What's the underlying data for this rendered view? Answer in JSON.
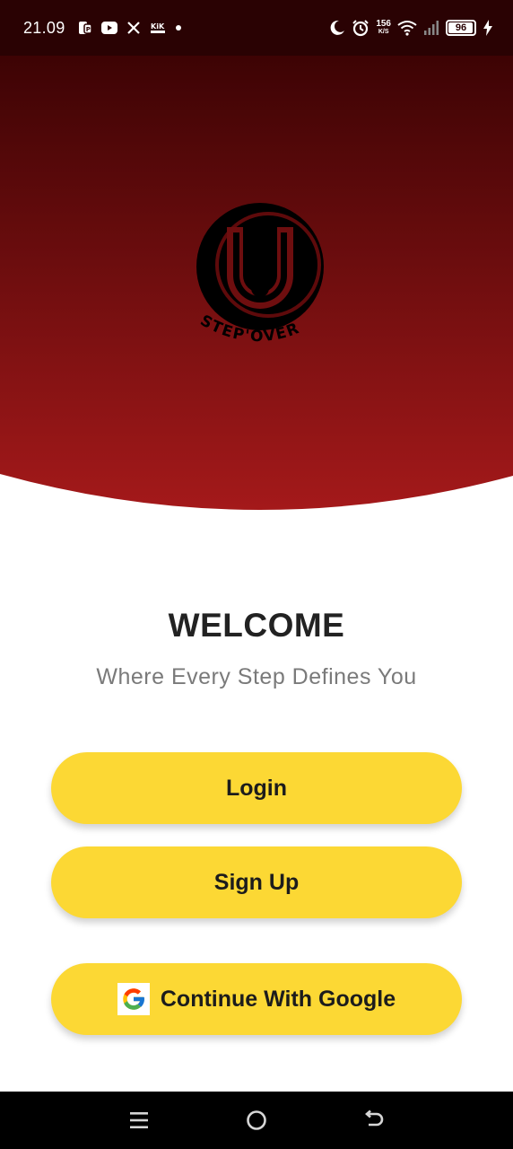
{
  "status_bar": {
    "time": "21.09",
    "net_speed_value": "156",
    "net_speed_unit": "K/S",
    "battery_level": "96",
    "notification_icons": [
      "facebook-pages-icon",
      "youtube-icon",
      "x-icon",
      "kik-icon",
      "dot-icon"
    ],
    "system_icons": [
      "moon-icon",
      "alarm-icon",
      "wifi-icon",
      "signal-icon",
      "battery-icon",
      "charging-icon"
    ]
  },
  "brand": {
    "logo_text": "STEP'OVER"
  },
  "main": {
    "title": "WELCOME",
    "tagline": "Where Every Step Defines You"
  },
  "buttons": {
    "login_label": "Login",
    "signup_label": "Sign Up",
    "google_label": "Continue With Google"
  },
  "colors": {
    "hero_top": "#3d0304",
    "hero_bottom": "#a4191a",
    "button_bg": "#fcd834",
    "title_text": "#222222",
    "tagline_text": "#7a7a7a"
  }
}
